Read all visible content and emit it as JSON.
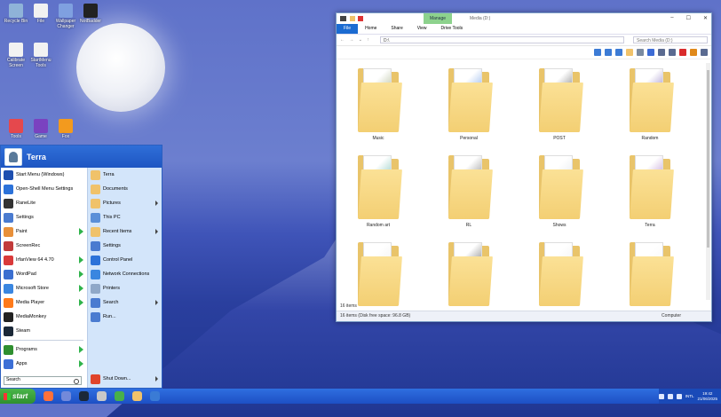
{
  "desktop": {
    "icons": [
      {
        "label": "Recycle Bin",
        "color": "#8fb3d8"
      },
      {
        "label": "File",
        "color": "#f1f1f1"
      },
      {
        "label": "Wallpaper Changer",
        "color": "#7fa0e0"
      },
      {
        "label": "NotBadder",
        "color": "#222222"
      },
      {
        "label": "Calibrate Screen",
        "color": "#f2f2f2"
      },
      {
        "label": "StartMenu Tools",
        "color": "#f2f2f2"
      },
      {
        "label": "Tools",
        "color": "#e5484d"
      },
      {
        "label": "Game",
        "color": "#7a42c0"
      },
      {
        "label": "Fox",
        "color": "#f39a1e"
      }
    ]
  },
  "start_menu": {
    "user": "Terra",
    "left_items": [
      {
        "label": "Start Menu (Windows)",
        "color": "#1e4fb0",
        "arrow": false
      },
      {
        "label": "Open-Shell Menu Settings",
        "color": "#2c72d9",
        "arrow": false
      },
      {
        "label": "RaneLite",
        "color": "#333333",
        "arrow": false
      },
      {
        "label": "Settings",
        "color": "#4a7bd0",
        "arrow": false
      },
      {
        "label": "Paint",
        "color": "#e8903a",
        "arrow": true
      },
      {
        "label": "ScreenRec",
        "color": "#c23b3b",
        "arrow": false
      },
      {
        "label": "IrfanView 64 4.70",
        "color": "#d93a3a",
        "arrow": true
      },
      {
        "label": "WordPad",
        "color": "#3b6fd0",
        "arrow": true
      },
      {
        "label": "Microsoft Store",
        "color": "#3a86e0",
        "arrow": true
      },
      {
        "label": "Media Player",
        "color": "#ff7a1a",
        "arrow": true
      },
      {
        "label": "MediaMonkey",
        "color": "#222222",
        "arrow": false
      },
      {
        "label": "Steam",
        "color": "#1b2838",
        "arrow": false
      }
    ],
    "bottom_items": [
      {
        "label": "Programs",
        "color": "#2f8f2f"
      },
      {
        "label": "Apps",
        "color": "#3c6fd6"
      }
    ],
    "search_placeholder": "Search",
    "right_items": [
      {
        "label": "Terra",
        "color": "#f0c26a",
        "arrow": false
      },
      {
        "label": "Documents",
        "color": "#f0c26a",
        "arrow": false
      },
      {
        "label": "Pictures",
        "color": "#f0c26a",
        "arrow": true
      },
      {
        "label": "This PC",
        "color": "#5a8fd8",
        "arrow": false
      },
      {
        "label": "Recent Items",
        "color": "#f0c26a",
        "arrow": true
      },
      {
        "label": "Settings",
        "color": "#4a7bd0",
        "arrow": false
      },
      {
        "label": "Control Panel",
        "color": "#2c72d9",
        "arrow": false
      },
      {
        "label": "Network Connections",
        "color": "#3a86e0",
        "arrow": false
      },
      {
        "label": "Printers",
        "color": "#8fa8c8",
        "arrow": false
      },
      {
        "label": "Search",
        "color": "#4a7bd0",
        "arrow": true
      },
      {
        "label": "Run...",
        "color": "#4a7bd0",
        "arrow": false
      }
    ],
    "shutdown_label": "Shut Down..."
  },
  "taskbar": {
    "start_label": "start",
    "apps": [
      {
        "name": "firefox",
        "color": "#ff7139"
      },
      {
        "name": "discord",
        "color": "#7289da"
      },
      {
        "name": "steam",
        "color": "#1b2838"
      },
      {
        "name": "chat",
        "color": "#c8c8c8"
      },
      {
        "name": "xbox",
        "color": "#48b04a"
      },
      {
        "name": "explorer",
        "color": "#f0c26a"
      },
      {
        "name": "media",
        "color": "#3a7bd5"
      }
    ],
    "tray_lang": "INTL",
    "time": "19:42",
    "date": "21/06/2025"
  },
  "explorer": {
    "manage_tab": "Manage",
    "title": "Media (D:)",
    "ribbon_tabs": [
      "File",
      "Home",
      "Share",
      "View",
      "Drive Tools"
    ],
    "address": "D:\\",
    "search_placeholder": "Search Media (D:)",
    "toolbar_icons": [
      {
        "name": "layout",
        "color": "#3c7bd5"
      },
      {
        "name": "panes",
        "color": "#3c7bd5"
      },
      {
        "name": "details",
        "color": "#3c7bd5"
      },
      {
        "name": "folder",
        "color": "#f0c26a"
      },
      {
        "name": "properties",
        "color": "#7a8aa0"
      },
      {
        "name": "cut",
        "color": "#3c6bd5"
      },
      {
        "name": "copy",
        "color": "#5a6a90"
      },
      {
        "name": "paste",
        "color": "#5a6a90"
      },
      {
        "name": "delete",
        "color": "#d92b2b"
      },
      {
        "name": "check",
        "color": "#e0891a"
      },
      {
        "name": "rename",
        "color": "#5a6a90"
      }
    ],
    "folders": [
      {
        "label": "Music",
        "accent": "#7a8a4a"
      },
      {
        "label": "Personal",
        "accent": "#2b6fd8"
      },
      {
        "label": "POST",
        "accent": "#1a1a1a"
      },
      {
        "label": "Random",
        "accent": "#4a2a9a"
      },
      {
        "label": "Random art",
        "accent": "#2a9a8a"
      },
      {
        "label": "RL",
        "accent": "#3a3a3a"
      },
      {
        "label": "Shows",
        "accent": "#d0d8e0"
      },
      {
        "label": "Terra",
        "accent": "#8a4ab0"
      },
      {
        "label": "",
        "accent": "#e6e6e6"
      },
      {
        "label": "",
        "accent": "#111111"
      },
      {
        "label": "",
        "accent": "#e6e6e6"
      },
      {
        "label": "",
        "accent": "#f2f2f2"
      }
    ],
    "status": "16 items",
    "info_left": "16 items (Disk free space: 96.8 GB)",
    "info_right": "Computer"
  }
}
